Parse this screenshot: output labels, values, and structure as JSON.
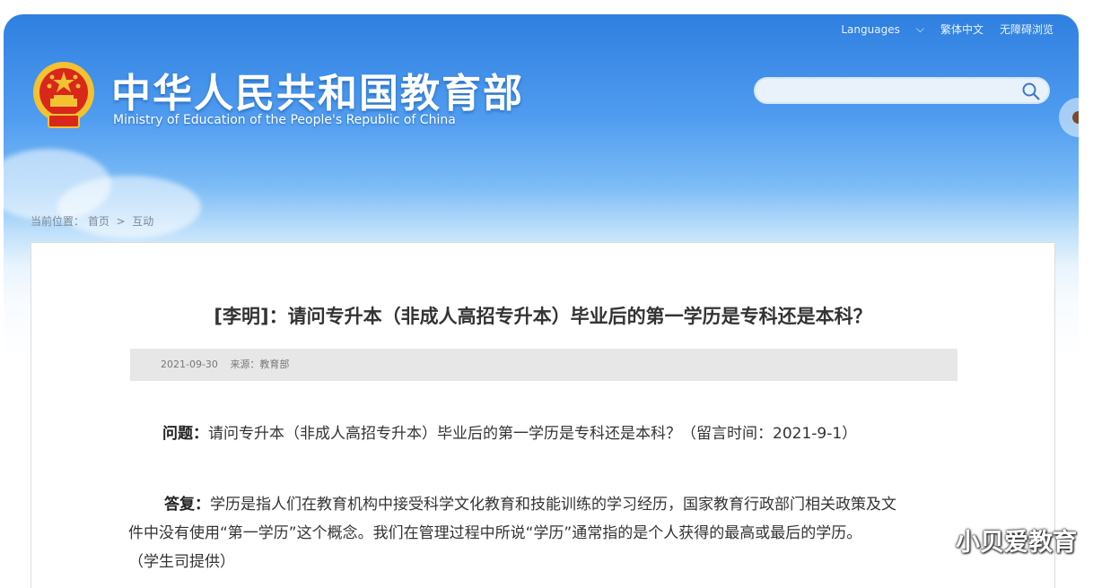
{
  "header": {
    "links": [
      "Languages",
      "繁体中文",
      "无障碍浏览"
    ],
    "title_cn": "中华人民共和国教育部",
    "title_en": "Ministry of Education of the People's Republic of China",
    "search": {
      "placeholder": "",
      "value": ""
    }
  },
  "breadcrumb": {
    "prefix": "当前位置：",
    "items": [
      "首页",
      "互动"
    ],
    "separator": ">"
  },
  "article": {
    "title": "[李明]：请问专升本（非成人高招专升本）毕业后的第一学历是专科还是本科？",
    "meta": {
      "date": "2021-09-30",
      "source": "来源：教育部"
    },
    "question_label": "问题：",
    "question_text": "请问专升本（非成人高招专升本）毕业后的第一学历是专科还是本科？（留言时间：2021-9-1）",
    "answer_label": "答复：",
    "answer_text_1": "学历是指人们在教育机构中接受科学文化教育和技能训练的学习经历，国家教育行政部门相关政策及文",
    "answer_text_2": "件中没有使用“第一学历”这个概念。我们在管理过程中所说“学历”通常指的是个人获得的最高或最后的学历。",
    "answer_text_3": "（学生司提供）"
  },
  "watermark": "小贝爱教育",
  "colors": {
    "header_blue": "#2f7fe0",
    "emblem_red": "#d9271c",
    "emblem_gold": "#f2c230"
  }
}
